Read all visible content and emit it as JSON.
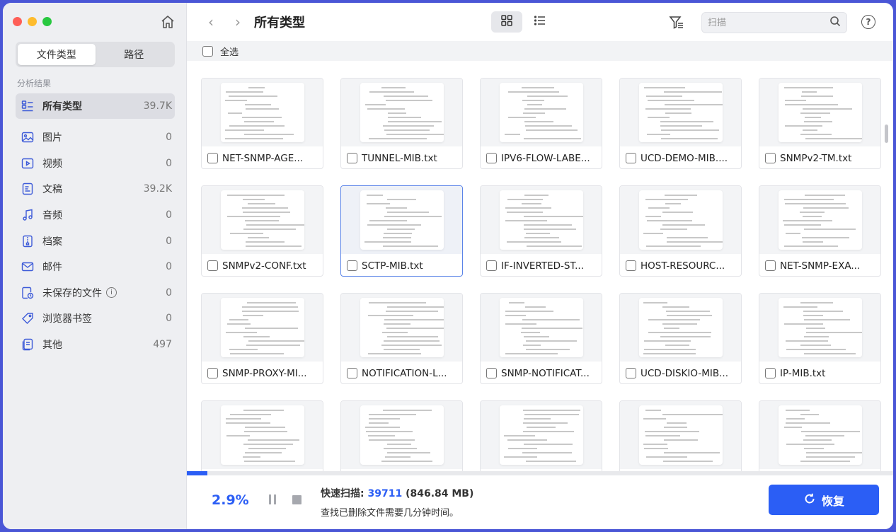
{
  "sidebar": {
    "tabs": [
      {
        "label": "文件类型",
        "active": true
      },
      {
        "label": "路径",
        "active": false
      }
    ],
    "section_label": "分析结果",
    "categories": [
      {
        "label": "所有类型",
        "count": "39.7K",
        "icon": "all-types-icon",
        "active": true
      },
      {
        "label": "图片",
        "count": "0",
        "icon": "image-icon"
      },
      {
        "label": "视频",
        "count": "0",
        "icon": "video-icon"
      },
      {
        "label": "文稿",
        "count": "39.2K",
        "icon": "document-icon"
      },
      {
        "label": "音频",
        "count": "0",
        "icon": "music-icon"
      },
      {
        "label": "档案",
        "count": "0",
        "icon": "archive-icon"
      },
      {
        "label": "邮件",
        "count": "0",
        "icon": "mail-icon"
      },
      {
        "label": "未保存的文件",
        "count": "0",
        "icon": "unsaved-file-icon",
        "info": "i"
      },
      {
        "label": "浏览器书签",
        "count": "0",
        "icon": "bookmark-tag-icon"
      },
      {
        "label": "其他",
        "count": "497",
        "icon": "other-file-icon"
      }
    ]
  },
  "toolbar": {
    "back": "‹",
    "forward": "›",
    "title": "所有类型",
    "search_placeholder": "扫描",
    "help": "?"
  },
  "select_all_label": "全选",
  "files": [
    "NET-SNMP-AGE...",
    "TUNNEL-MIB.txt",
    "IPV6-FLOW-LABE...",
    "UCD-DEMO-MIB....",
    "SNMPv2-TM.txt",
    "SNMPv2-CONF.txt",
    "SCTP-MIB.txt",
    "IF-INVERTED-ST...",
    "HOST-RESOURC...",
    "NET-SNMP-EXA...",
    "SNMP-PROXY-MI...",
    "NOTIFICATION-L...",
    "SNMP-NOTIFICAT...",
    "UCD-DISKIO-MIB...",
    "IP-MIB.txt",
    "",
    "",
    "",
    "",
    ""
  ],
  "selected_file_index": 6,
  "status": {
    "percent_text": "2.9%",
    "progress": 0.029,
    "scan_label": "快速扫描: ",
    "scan_count": "39711",
    "scan_size": " (846.84 MB)",
    "hint": "查找已删除文件需要几分钟时间。",
    "recover_label": "恢复"
  },
  "colors": {
    "accent": "#2b5ef5",
    "sidebar_bg": "#eeeff2",
    "icon_blue": "#3c5ad8"
  }
}
